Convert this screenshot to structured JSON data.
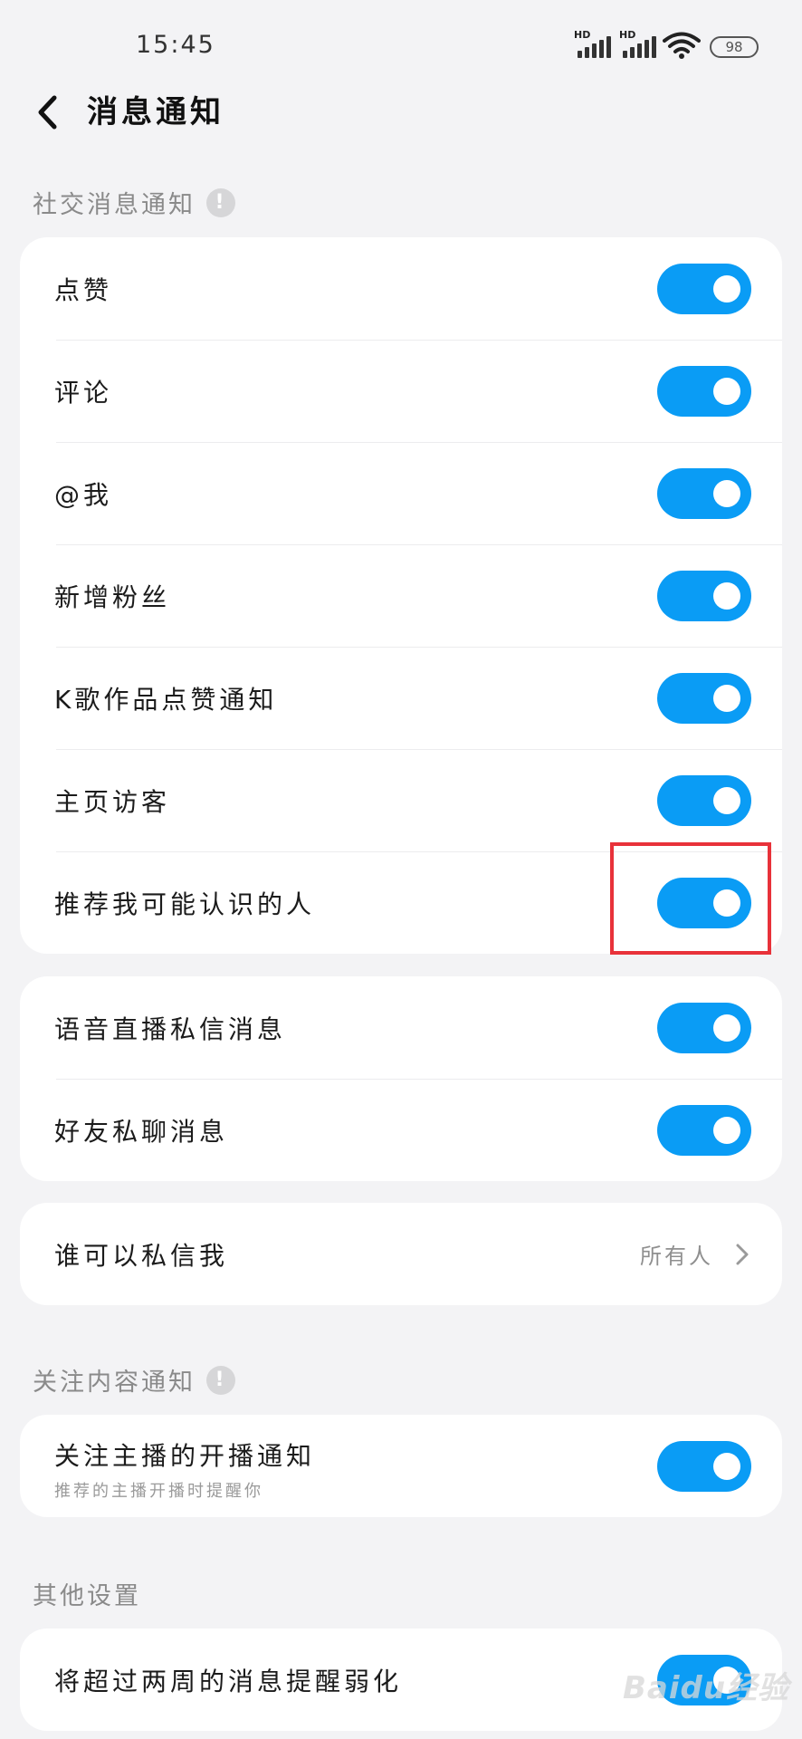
{
  "status_bar": {
    "time": "15:45",
    "battery": "98",
    "signal1_label": "HD",
    "signal2_label": "HD"
  },
  "header": {
    "title": "消息通知"
  },
  "sections": {
    "social": {
      "label": "社交消息通知"
    },
    "follow": {
      "label": "关注内容通知"
    },
    "other": {
      "label": "其他设置"
    }
  },
  "card1": {
    "items": [
      {
        "label": "点赞",
        "on": true
      },
      {
        "label": "评论",
        "on": true
      },
      {
        "label": "@我",
        "on": true
      },
      {
        "label": "新增粉丝",
        "on": true
      },
      {
        "label": "K歌作品点赞通知",
        "on": true
      },
      {
        "label": "主页访客",
        "on": true
      },
      {
        "label": "推荐我可能认识的人",
        "on": true
      }
    ]
  },
  "card2": {
    "items": [
      {
        "label": "语音直播私信消息",
        "on": true
      },
      {
        "label": "好友私聊消息",
        "on": true
      }
    ]
  },
  "card3": {
    "label": "谁可以私信我",
    "value": "所有人"
  },
  "card4": {
    "label": "关注主播的开播通知",
    "sublabel": "推荐的主播开播时提醒你",
    "on": true
  },
  "card5": {
    "label": "将超过两周的消息提醒弱化",
    "on": true
  },
  "watermark": {
    "text": "Baidu经验"
  },
  "colors": {
    "toggle_on": "#0a9cf5",
    "highlight": "#e8323a"
  }
}
